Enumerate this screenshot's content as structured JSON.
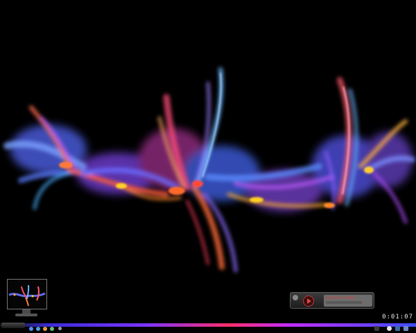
{
  "desktop": {
    "background_color": "#000000",
    "wallpaper_icon": "abstract-light-streaks-wallpaper"
  },
  "monitor_widget": {
    "icon": "monitor-preview-icon"
  },
  "media_player": {
    "play_icon": "play-icon",
    "track_title": "Lyrics in Vista",
    "accent_color": "#d23c3c"
  },
  "clock": {
    "time": "0:01:07"
  },
  "taskbar": {
    "start_icon": "start-button-icon",
    "quick_launch": [
      "app-icon-1",
      "app-icon-2",
      "app-icon-3",
      "app-icon-4",
      "app-icon-5"
    ],
    "tray": [
      "network-icon",
      "speaker-icon",
      "info-icon",
      "chat-icon"
    ],
    "stripe_colors": [
      "#3b2bd8",
      "#7b34ff",
      "#ff2d6a",
      "#c02cff",
      "#3c4cff"
    ]
  }
}
